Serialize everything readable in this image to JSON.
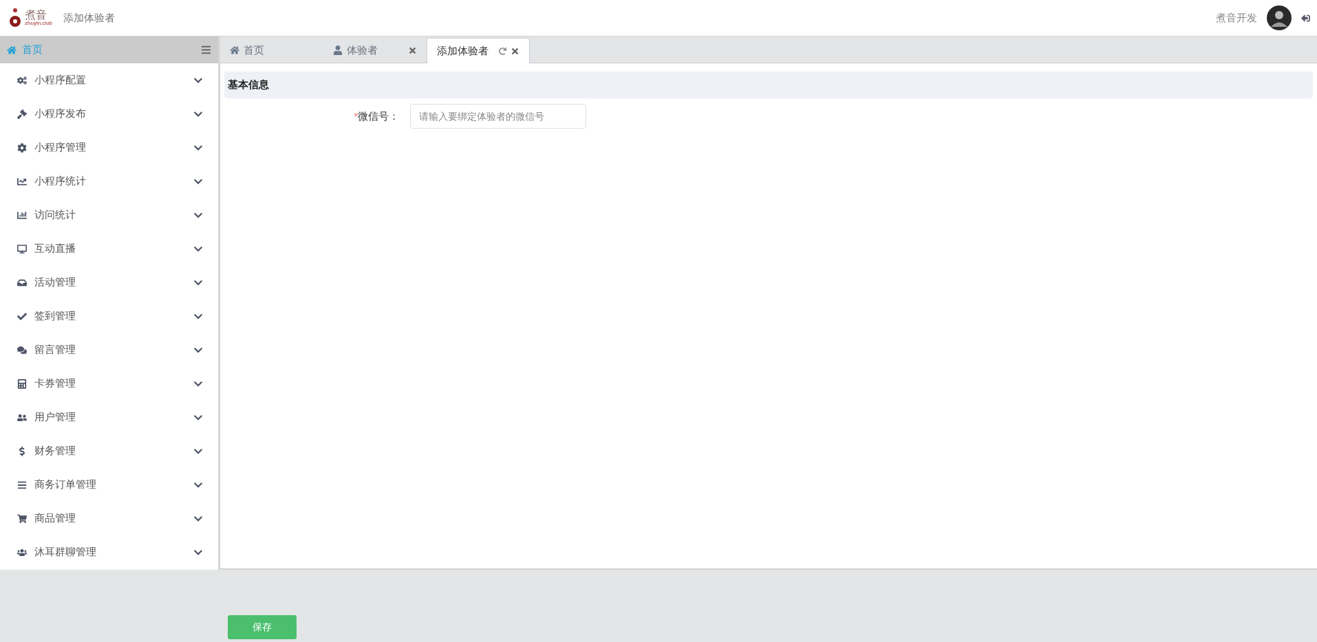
{
  "header": {
    "logo_name": "煮音",
    "logo_url": "zhuyin.club",
    "page_title": "添加体验者",
    "user_name": "煮音开发"
  },
  "sidebar": {
    "home": {
      "label": "首页",
      "selected": true
    },
    "items": [
      {
        "label": "小程序配置",
        "expanded": false
      },
      {
        "label": "小程序发布",
        "expanded": false
      },
      {
        "label": "小程序管理",
        "expanded": false
      },
      {
        "label": "小程序统计",
        "expanded": false
      },
      {
        "label": "访问统计",
        "expanded": false
      },
      {
        "label": "互动直播",
        "expanded": false
      },
      {
        "label": "活动管理",
        "expanded": false
      },
      {
        "label": "签到管理",
        "expanded": false
      },
      {
        "label": "留言管理",
        "expanded": false
      },
      {
        "label": "卡券管理",
        "expanded": false
      },
      {
        "label": "用户管理",
        "expanded": false
      },
      {
        "label": "财务管理",
        "expanded": false
      },
      {
        "label": "商务订单管理",
        "expanded": false
      },
      {
        "label": "商品管理",
        "expanded": false
      },
      {
        "label": "沐耳群聊管理",
        "expanded": false
      }
    ]
  },
  "tabs": [
    {
      "label": "首页",
      "selected": false,
      "closable": false,
      "refreshable": false
    },
    {
      "label": "体验者",
      "selected": false,
      "closable": true,
      "refreshable": false
    },
    {
      "label": "添加体验者",
      "selected": true,
      "closable": true,
      "refreshable": true
    }
  ],
  "section": {
    "title": "基本信息"
  },
  "form": {
    "fields": [
      {
        "label": "微信号：",
        "required_mark": "*",
        "placeholder": "请输入要绑定体验者的微信号"
      }
    ]
  },
  "footer": {
    "save_button": "保存"
  }
}
